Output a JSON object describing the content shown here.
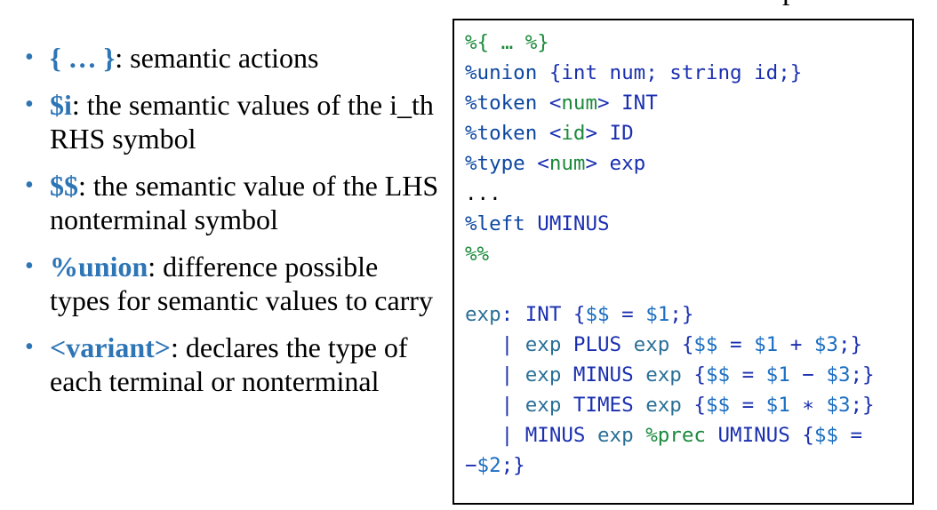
{
  "heading_fragment": "p",
  "bullets": [
    {
      "term": "{ … }",
      "text": ": semantic actions"
    },
    {
      "term": "$i",
      "text": ": the semantic values of the i_th RHS symbol"
    },
    {
      "term": "$$",
      "text": ": the semantic value of the LHS nonterminal symbol"
    },
    {
      "term": "%union",
      "text": ": difference possible types for semantic values to carry"
    },
    {
      "term": "<variant>",
      "text": ": declares the type of each terminal or nonterminal"
    }
  ],
  "code": {
    "line1": "%{ … %}",
    "line2a": "%union",
    "line2b": " {int num; string id;}",
    "line3a": "%token",
    "line3b": " <",
    "line3c": "num",
    "line3d": "> INT",
    "line4a": "%token",
    "line4b": " <",
    "line4c": "id",
    "line4d": "> ID",
    "line5a": "%type",
    "line5b": " <",
    "line5c": "num",
    "line5d": "> exp",
    "line6": "...",
    "line7a": "%left",
    "line7b": " UMINUS",
    "line8": "%%",
    "line9": "",
    "line10a": "exp",
    "line10b": ": INT {",
    "line10c": "$$",
    "line10d": " = ",
    "line10e": "$1",
    "line10f": ";}",
    "line11a": "   | ",
    "line11b": "exp",
    "line11c": " PLUS ",
    "line11d": "exp",
    "line11e": " {",
    "line11f": "$$",
    "line11g": " = ",
    "line11h": "$1",
    "line11i": " + ",
    "line11j": "$3",
    "line11k": ";}",
    "line12a": "   | ",
    "line12b": "exp",
    "line12c": " MINUS ",
    "line12d": "exp",
    "line12e": " {",
    "line12f": "$$",
    "line12g": " = ",
    "line12h": "$1",
    "line12i": " − ",
    "line12j": "$3",
    "line12k": ";}",
    "line13a": "   | ",
    "line13b": "exp",
    "line13c": " TIMES ",
    "line13d": "exp",
    "line13e": " {",
    "line13f": "$$",
    "line13g": " = ",
    "line13h": "$1",
    "line13i": " ∗ ",
    "line13j": "$3",
    "line13k": ";}",
    "line14a": "   | MINUS ",
    "line14b": "exp",
    "line14c": " %prec",
    "line14d": " UMINUS {",
    "line14e": "$$",
    "line14f": " =",
    "line15a": "−",
    "line15b": "$2",
    "line15c": ";}"
  },
  "colors": {
    "bullet_term": "#2e75b6",
    "code_directive": "#0d47a1",
    "code_type": "#1b8a3c",
    "code_nonterminal": "#2a6f97",
    "code_dollar": "#1b6ec2"
  }
}
